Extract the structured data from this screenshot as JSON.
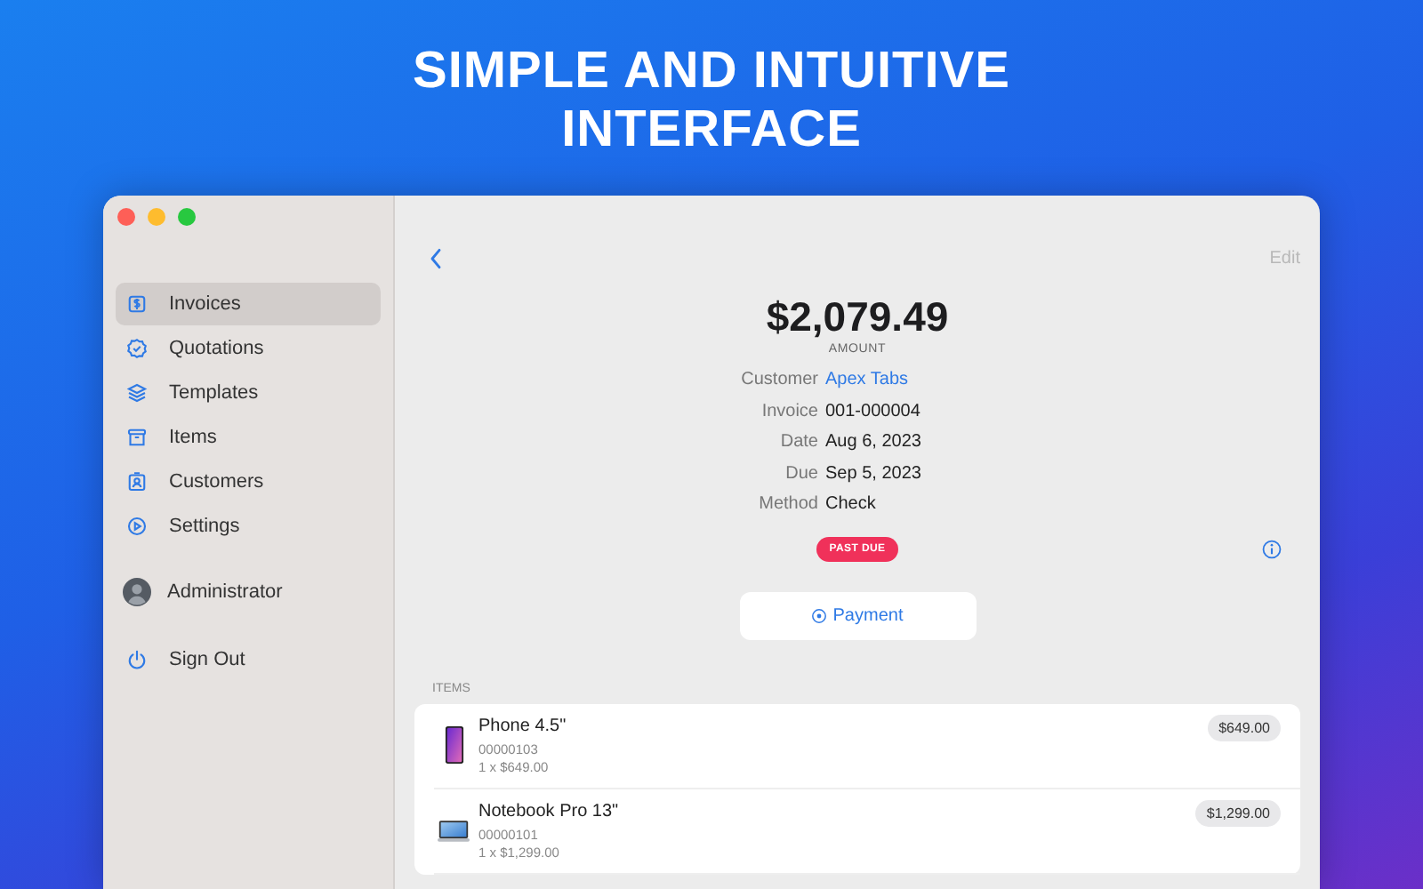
{
  "headline": [
    "SIMPLE AND INTUITIVE",
    "INTERFACE"
  ],
  "sidebar": {
    "items": [
      {
        "label": "Invoices",
        "selected": true
      },
      {
        "label": "Quotations",
        "selected": false
      },
      {
        "label": "Templates",
        "selected": false
      },
      {
        "label": "Items",
        "selected": false
      },
      {
        "label": "Customers",
        "selected": false
      },
      {
        "label": "Settings",
        "selected": false
      }
    ],
    "account": "Administrator",
    "sign_out": "Sign Out"
  },
  "toolbar": {
    "edit": "Edit",
    "edit_disabled": true
  },
  "invoice": {
    "amount": "$2,079.49",
    "amount_label": "AMOUNT",
    "fields": [
      {
        "label": "Customer",
        "value": "Apex Tabs",
        "link": true
      },
      {
        "label": "Invoice",
        "value": "001-000004",
        "link": false
      },
      {
        "label": "Date",
        "value": "Aug 6, 2023",
        "link": false
      },
      {
        "label": "Due",
        "value": "Sep 5, 2023",
        "link": false
      },
      {
        "label": "Method",
        "value": "Check",
        "link": false
      }
    ],
    "status": "PAST DUE",
    "payment_button": "Payment"
  },
  "items": {
    "heading": "ITEMS",
    "rows": [
      {
        "kind": "phone",
        "name": "Phone 4.5\"",
        "sku": "00000103",
        "quantity": "1 x $649.00",
        "price": "$649.00"
      },
      {
        "kind": "laptop",
        "name": "Notebook Pro 13\"",
        "sku": "00000101",
        "quantity": "1 x $1,299.00",
        "price": "$1,299.00"
      }
    ]
  }
}
